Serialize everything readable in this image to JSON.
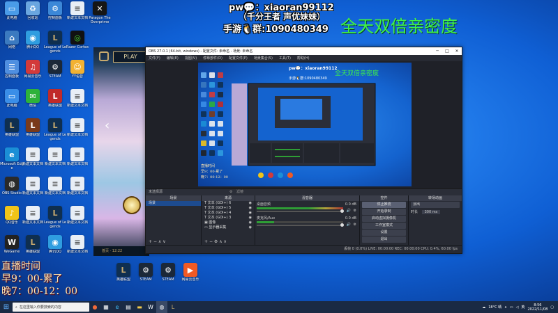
{
  "overlay": {
    "line1": "pw💬：xiaoran99112",
    "line2": "（千分王者 声优妹妹）",
    "line3": "手游🐧群:1090480349",
    "big": "全天双倍亲密度"
  },
  "schedule": {
    "title": "直播时间",
    "morning": "早9：00-累了",
    "evening": "晚7：00-12：00"
  },
  "desktop_icons": [
    {
      "id": "pc",
      "label": "此电脑",
      "icon": "computer-icon",
      "color": "#4a9be8"
    },
    {
      "id": "rec",
      "label": "回收站",
      "icon": "recycle-icon",
      "color": "#6aa6e0"
    },
    {
      "id": "ctrl",
      "label": "控制面板",
      "icon": "control-panel-icon",
      "color": "#3c88d8"
    },
    {
      "id": "net",
      "label": "网络",
      "icon": "network-icon",
      "color": "#3b7ac0"
    },
    {
      "id": "music",
      "label": "网易云音乐",
      "icon": "music-icon",
      "color": "#d33a3a"
    },
    {
      "id": "flag",
      "label": "腾讯QQ",
      "icon": "qq-icon",
      "color": "#2f9de0"
    },
    {
      "id": "wx",
      "label": "微信",
      "icon": "wechat-icon",
      "color": "#2db23a"
    },
    {
      "id": "edge",
      "label": "Microsoft Edge",
      "icon": "edge-icon",
      "color": "#1b8fd6"
    },
    {
      "id": "obs",
      "label": "OBS Studio",
      "icon": "obs-icon",
      "color": "#2a2a2a"
    },
    {
      "id": "qq",
      "label": "QQ音乐",
      "icon": "qq-music-icon",
      "color": "#f0c419"
    },
    {
      "id": "wegame",
      "label": "WeGame",
      "icon": "wegame-icon",
      "color": "#222"
    },
    {
      "id": "lol1",
      "label": "英雄联盟",
      "icon": "lol-icon",
      "color": "#0f2f50"
    },
    {
      "id": "txt1",
      "label": "新建文本文档",
      "icon": "document-icon",
      "color": "#e8eef6"
    },
    {
      "id": "lol2",
      "label": "League of Legends",
      "icon": "lol-icon",
      "color": "#0f2f50"
    },
    {
      "id": "steam",
      "label": "STEAM",
      "icon": "steam-icon",
      "color": "#1b2838"
    },
    {
      "id": "razer",
      "label": "Razer Cortex",
      "icon": "razer-icon",
      "color": "#111"
    },
    {
      "id": "yy",
      "label": "YY语音",
      "icon": "yy-icon",
      "color": "#f2b233"
    },
    {
      "id": "para",
      "label": "Paragon The Overprime",
      "icon": "paragon-icon",
      "color": "#161616"
    }
  ],
  "lol_client": {
    "play_label": "PLAY",
    "footer": "首页 · 12:22"
  },
  "obs": {
    "title": "OBS 27.0.1 (64-bit, windows) - 配置文件: 未命名 - 场景: 未命名",
    "menu": [
      "文件(F)",
      "编辑(E)",
      "视图(V)",
      "停靠部件(D)",
      "配置文件(P)",
      "场景集合(S)",
      "工具(T)",
      "帮助(H)"
    ],
    "scenes_header": "场景",
    "scenes": [
      "场景"
    ],
    "sources_header": "来源",
    "sources": [
      "文本 (GDI+) 6",
      "文本 (GDI+) 5",
      "文本 (GDI+) 4",
      "文本 (GDI+) 3",
      "图像",
      "显示器采集"
    ],
    "mixer_header": "混音器",
    "mixer": [
      {
        "name": "桌面音频",
        "db": "0.0 dB"
      },
      {
        "name": "麦克风/Aux",
        "db": "0.0 dB"
      }
    ],
    "transitions_header": "转场动画",
    "transition_value": "淡出",
    "duration_label": "时长",
    "duration_value": "300 ms",
    "controls_header": "控件",
    "controls": [
      "停止推流",
      "开始录制",
      "启动虚拟摄像机",
      "工作室模式",
      "设置",
      "退出"
    ],
    "status": "丢帧 0 (0.0%)   LIVE: 00:00:00   REC: 00:00:00   CPU: 0.4%, 60.00 fps",
    "filter_label": "滤镜",
    "scene_label": "未选择源"
  },
  "taskbar": {
    "search_placeholder": "在这里输入你要搜索的内容",
    "weather": "18°C 晴",
    "time": "8:56",
    "date": "2022/11/08",
    "lang": "英"
  }
}
